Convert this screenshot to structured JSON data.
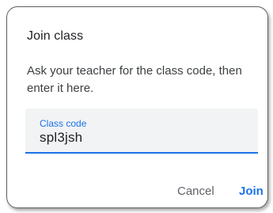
{
  "dialog": {
    "title": "Join class",
    "description": "Ask your teacher for the class code, then enter it here.",
    "field": {
      "label": "Class code",
      "value": "spl3jsh"
    },
    "buttons": {
      "cancel_label": "Cancel",
      "join_label": "Join"
    }
  },
  "colors": {
    "accent": "#1a73e8",
    "field_background": "#f1f3f4"
  }
}
